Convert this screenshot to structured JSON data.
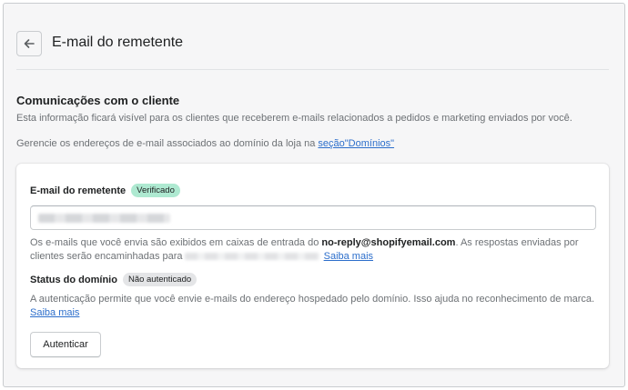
{
  "header": {
    "title": "E-mail do remetente",
    "back_icon": "arrow-left-icon"
  },
  "section": {
    "title": "Comunicações com o cliente",
    "description": "Esta informação ficará visível para os clientes que receberem e-mails relacionados a pedidos e marketing enviados por você.",
    "manage_prefix": "Gerencie os endereços de e-mail associados ao domínio da loja na ",
    "manage_link": "seção\"Domínios\""
  },
  "sender": {
    "label": "E-mail do remetente",
    "badge": "Verificado",
    "input_value": "",
    "help_prefix": "Os e-mails que você envia são exibidos em caixas de entrada do ",
    "help_email": "no-reply@shopifyemail.com",
    "help_middle": ". As respostas enviadas por clientes serão encaminhadas para",
    "help_link": "Saiba mais"
  },
  "domain": {
    "label": "Status do domínio",
    "badge": "Não autenticado",
    "description": "A autenticação permite que você envie e-mails do endereço hospedado pelo domínio. Isso ajuda no reconhecimento de marca.",
    "link": "Saiba mais",
    "button": "Autenticar"
  },
  "colors": {
    "success_badge": "#aee9d1",
    "neutral_badge": "#e4e5e7",
    "link": "#2c6ecb",
    "background": "#f6f6f7"
  }
}
